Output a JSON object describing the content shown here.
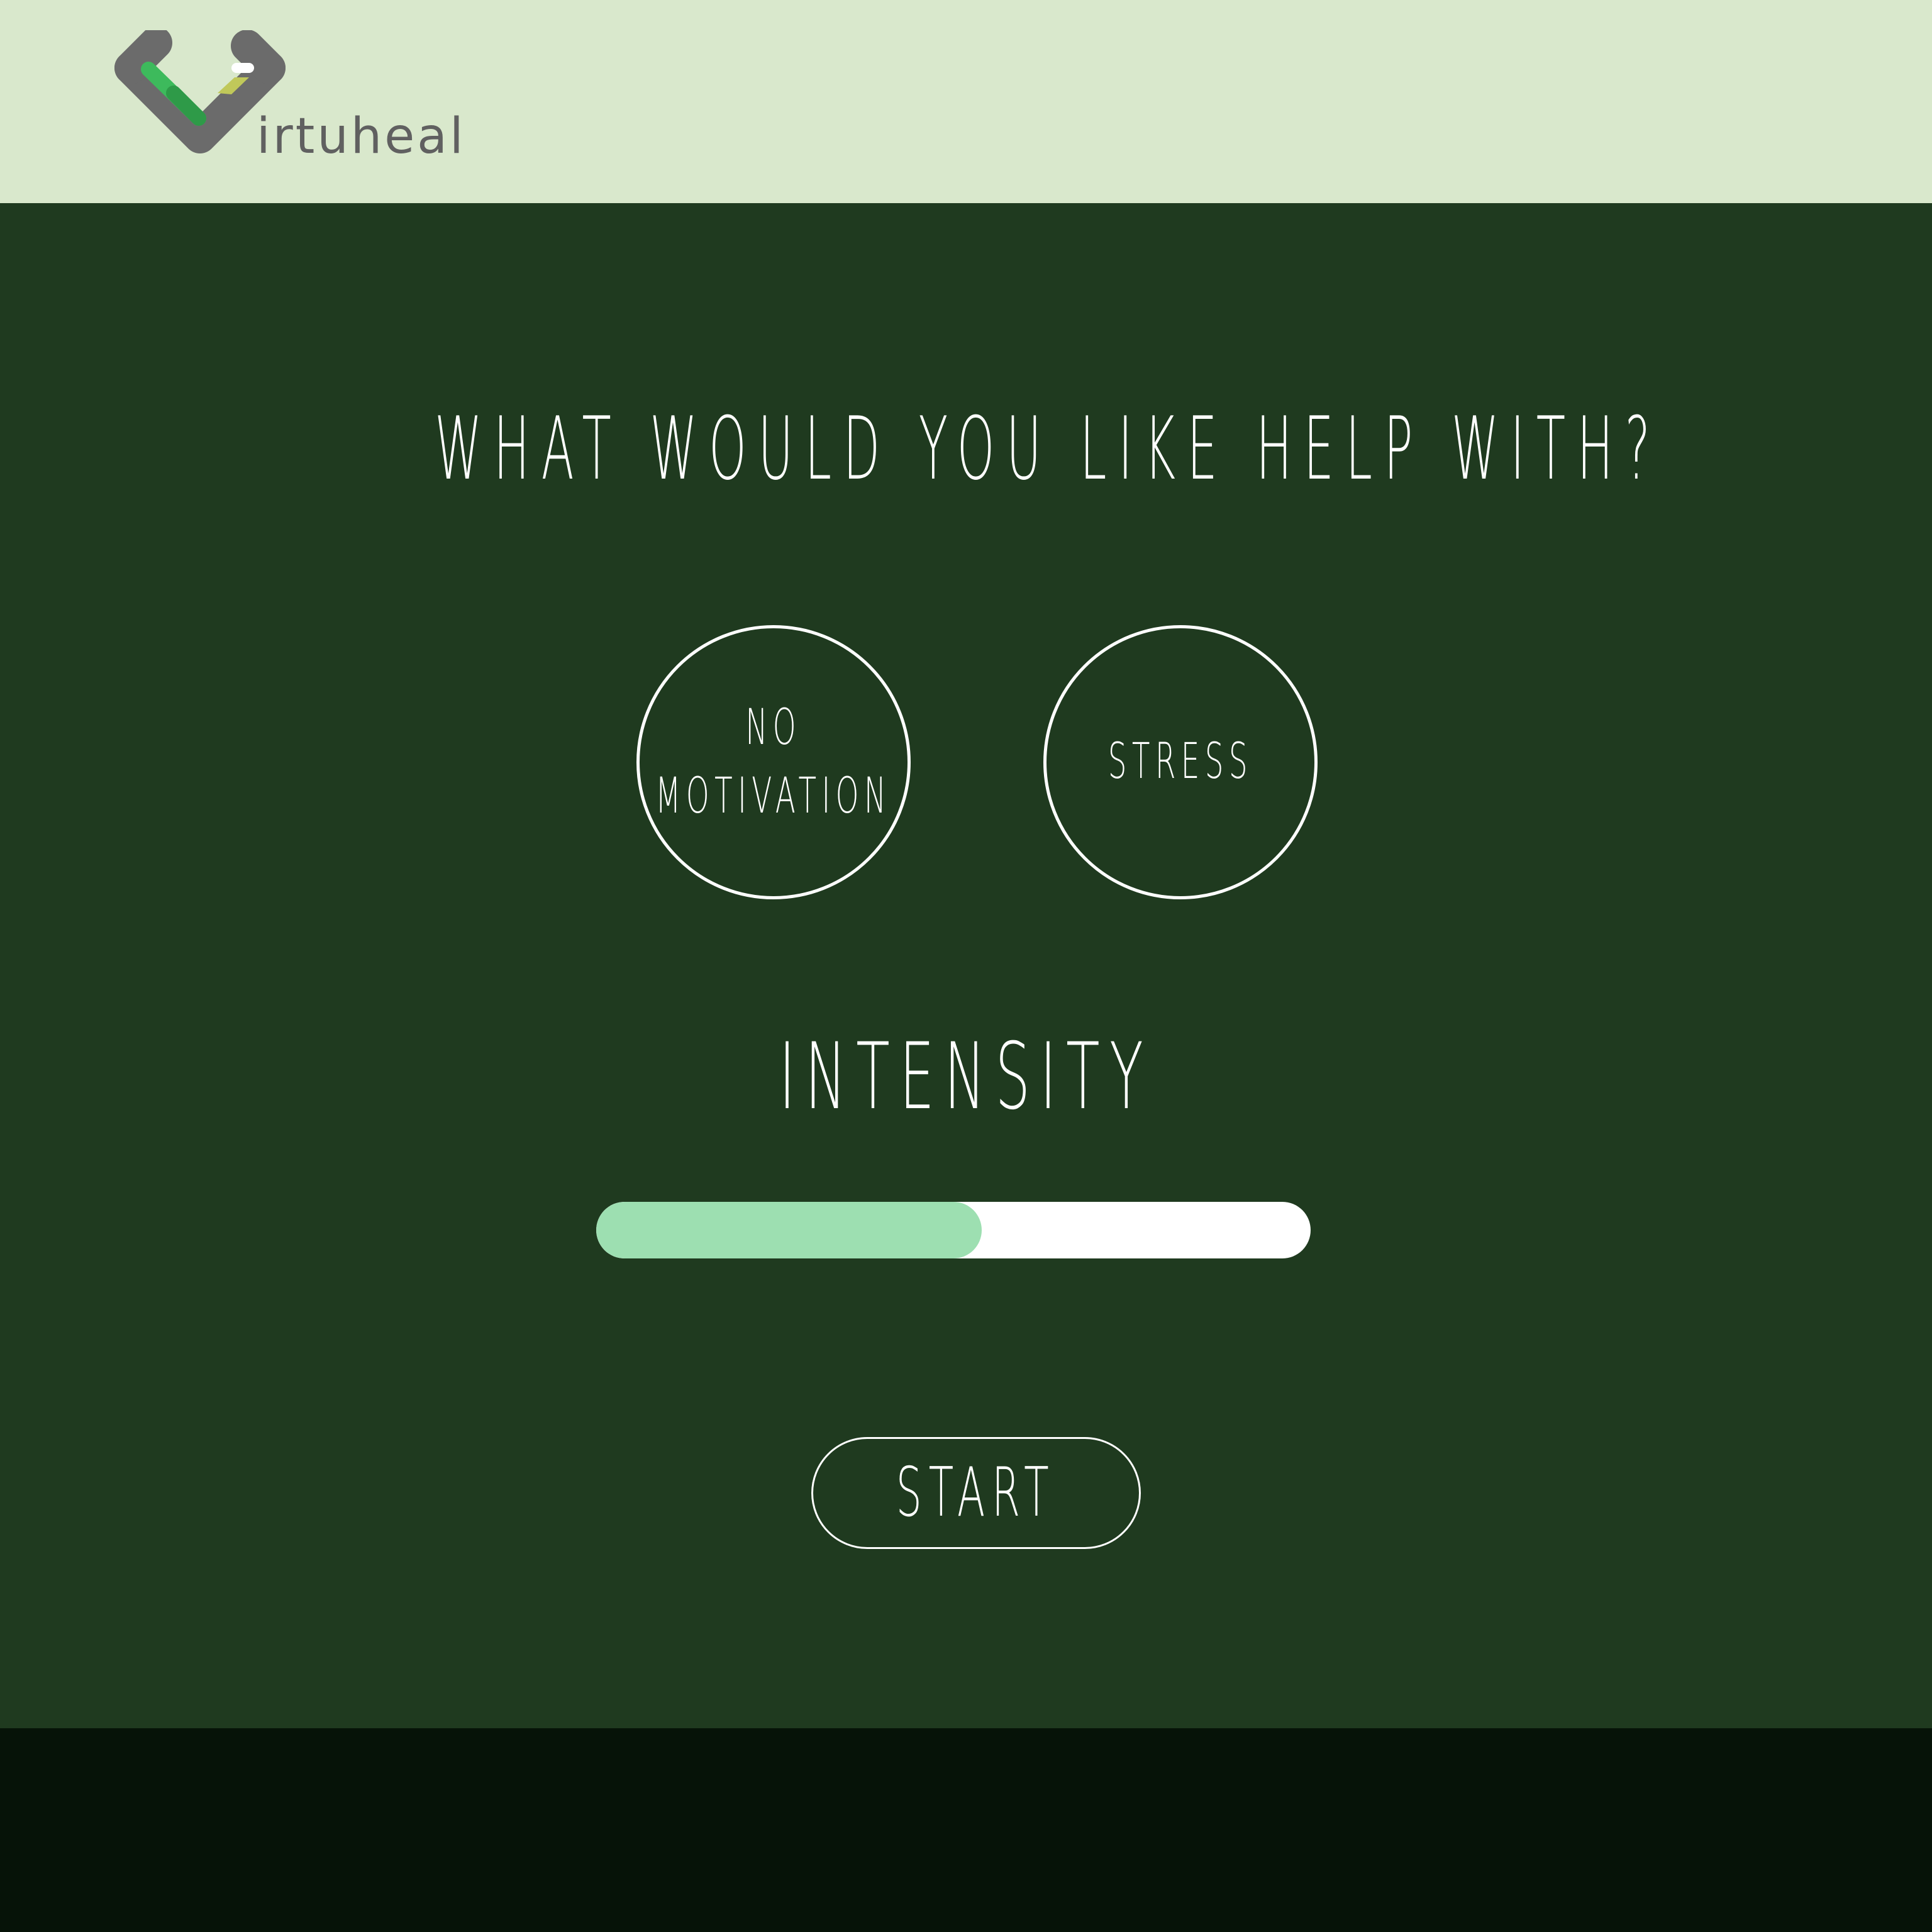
{
  "header": {
    "brand": "irtuheal",
    "logo_icon": "virtuheal-v-heart-logo"
  },
  "main": {
    "title": "WHAT WOULD YOU LIKE HELP WITH?",
    "options": [
      {
        "label": "NO\nMOTIVATION"
      },
      {
        "label": "STRESS"
      }
    ],
    "intensity_label": "INTENSITY",
    "intensity_value": 0.54,
    "start_label": "START"
  },
  "colors": {
    "header_bg": "#d9e8cc",
    "main_bg": "#1f3a1f",
    "footer_bg": "#061308",
    "slider_fill": "#9ddfb1",
    "slider_track": "#ffffff",
    "text": "#ffffff",
    "logo_gray": "#6b6b6b",
    "logo_green": "#3dba5c",
    "logo_lime": "#c0c85a"
  }
}
